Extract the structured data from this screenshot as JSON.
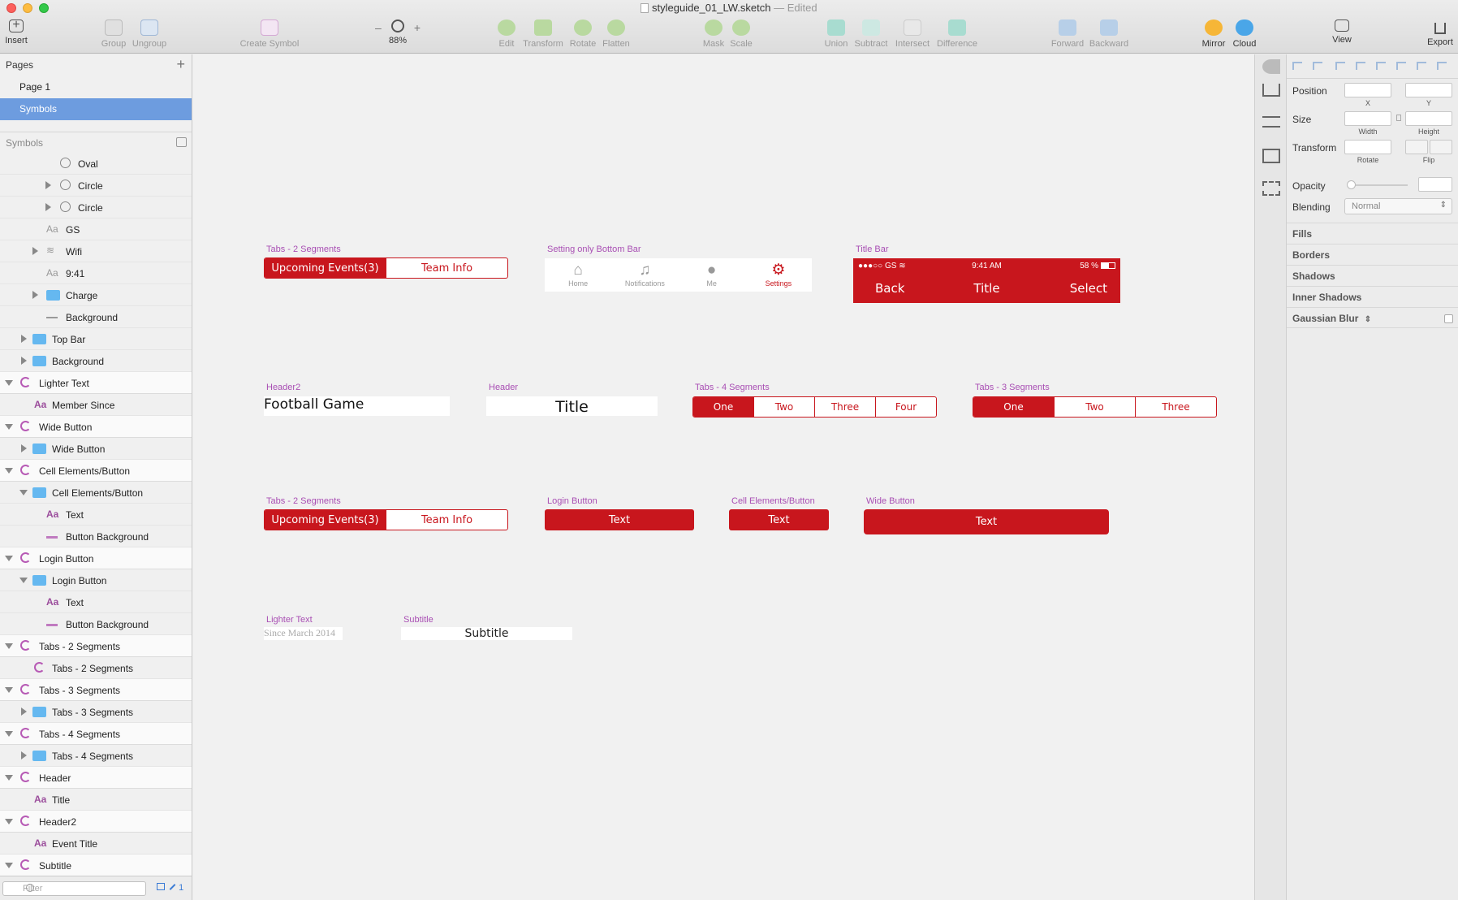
{
  "window": {
    "title": "styleguide_01_LW.sketch",
    "status": "— Edited"
  },
  "toolbar": {
    "insert": "Insert",
    "group": "Group",
    "ungroup": "Ungroup",
    "create_symbol": "Create Symbol",
    "zoom": "88%",
    "zoom_minus": "–",
    "zoom_plus": "+",
    "edit": "Edit",
    "transform": "Transform",
    "rotate": "Rotate",
    "flatten": "Flatten",
    "mask": "Mask",
    "scale": "Scale",
    "union": "Union",
    "subtract": "Subtract",
    "intersect": "Intersect",
    "difference": "Difference",
    "forward": "Forward",
    "backward": "Backward",
    "mirror": "Mirror",
    "cloud": "Cloud",
    "view": "View",
    "export": "Export"
  },
  "pages": {
    "header": "Pages",
    "add": "+",
    "items": [
      "Page 1",
      "Symbols"
    ]
  },
  "layers": {
    "header": "Symbols",
    "filter_placeholder": "Filter",
    "filter_count": "1",
    "items": [
      {
        "label": "Oval"
      },
      {
        "label": "Circle"
      },
      {
        "label": "Circle"
      },
      {
        "label": "GS"
      },
      {
        "label": "Wifi"
      },
      {
        "label": "9:41"
      },
      {
        "label": "Charge"
      },
      {
        "label": "Background"
      },
      {
        "label": "Top Bar"
      },
      {
        "label": "Background"
      },
      {
        "label": "Lighter Text"
      },
      {
        "label": "Member Since"
      },
      {
        "label": "Wide Button"
      },
      {
        "label": "Wide Button"
      },
      {
        "label": "Cell Elements/Button"
      },
      {
        "label": "Cell Elements/Button"
      },
      {
        "label": "Text"
      },
      {
        "label": "Button Background"
      },
      {
        "label": "Login Button"
      },
      {
        "label": "Login Button"
      },
      {
        "label": "Text"
      },
      {
        "label": "Button Background"
      },
      {
        "label": "Tabs - 2 Segments"
      },
      {
        "label": "Tabs - 2 Segments"
      },
      {
        "label": "Tabs - 3 Segments"
      },
      {
        "label": "Tabs - 3 Segments"
      },
      {
        "label": "Tabs - 4 Segments"
      },
      {
        "label": "Tabs - 4 Segments"
      },
      {
        "label": "Header"
      },
      {
        "label": "Title"
      },
      {
        "label": "Header2"
      },
      {
        "label": "Event Title"
      },
      {
        "label": "Subtitle"
      }
    ],
    "aa": "Aa"
  },
  "canvas": {
    "tabs2a": {
      "label": "Tabs - 2 Segments",
      "tabs": [
        "Upcoming Events(3)",
        "Team Info"
      ]
    },
    "bottom_bar": {
      "label": "Setting only Bottom Bar",
      "items": [
        "Home",
        "Notifications",
        "Me",
        "Settings"
      ]
    },
    "title_bar": {
      "label": "Title Bar",
      "signal": "●●●○○ GS",
      "time": "9:41 AM",
      "battery": "58 %",
      "back": "Back",
      "title": "Title",
      "select": "Select"
    },
    "header2": {
      "label": "Header2",
      "text": "Football Game"
    },
    "header": {
      "label": "Header",
      "text": "Title"
    },
    "tabs4": {
      "label": "Tabs - 4 Segments",
      "tabs": [
        "One",
        "Two",
        "Three",
        "Four"
      ]
    },
    "tabs3": {
      "label": "Tabs - 3 Segments",
      "tabs": [
        "One",
        "Two",
        "Three"
      ]
    },
    "tabs2b": {
      "label": "Tabs - 2 Segments",
      "tabs": [
        "Upcoming Events(3)",
        "Team Info"
      ]
    },
    "login_button": {
      "label": "Login Button",
      "text": "Text"
    },
    "cell_button": {
      "label": "Cell Elements/Button",
      "text": "Text"
    },
    "wide_button": {
      "label": "Wide Button",
      "text": "Text"
    },
    "lighter_text": {
      "label": "Lighter Text",
      "text": "Since March 2014"
    },
    "subtitle": {
      "label": "Subtitle",
      "text": "Subtitle"
    }
  },
  "inspector": {
    "position": "Position",
    "x": "X",
    "y": "Y",
    "size": "Size",
    "width": "Width",
    "height": "Height",
    "transform": "Transform",
    "rotate": "Rotate",
    "flip": "Flip",
    "opacity": "Opacity",
    "blending": "Blending",
    "blend_value": "Normal",
    "fills": "Fills",
    "borders": "Borders",
    "shadows": "Shadows",
    "inner_shadows": "Inner Shadows",
    "gaussian_blur": "Gaussian Blur"
  },
  "colors": {
    "brand_red": "#c8161d",
    "symbol_purple": "#a94fb4",
    "selection_blue": "#6d9cdf",
    "folder_blue": "#65b8f0"
  }
}
